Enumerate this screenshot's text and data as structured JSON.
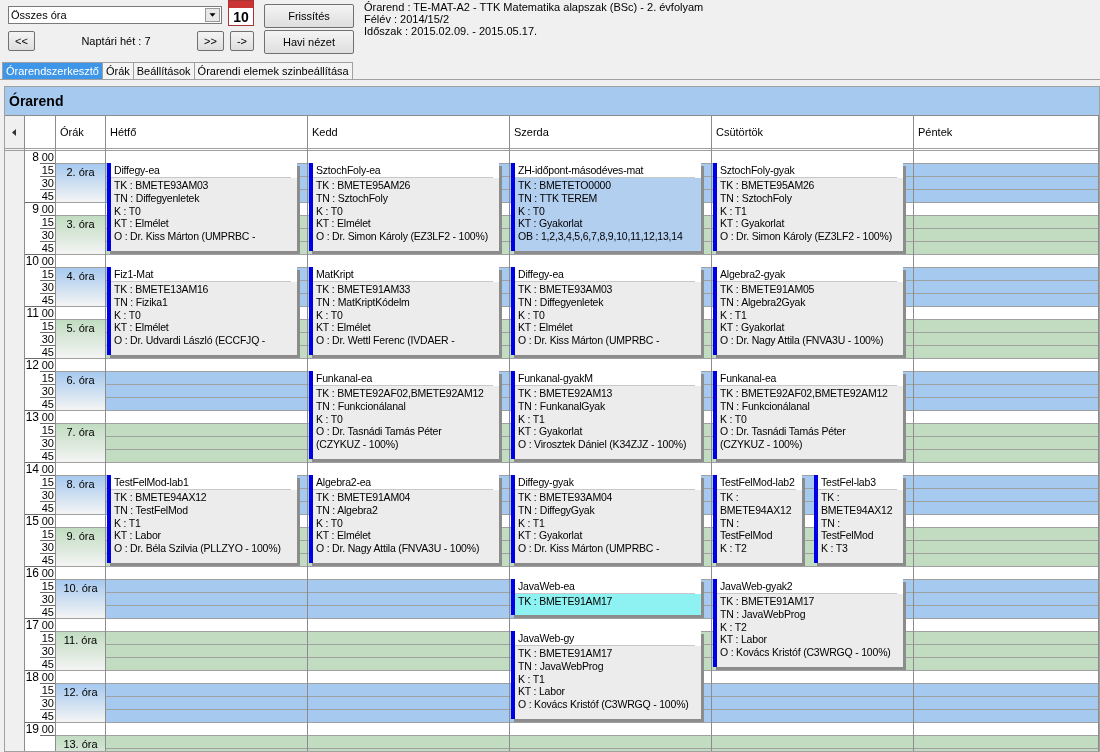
{
  "toolbar": {
    "filter": {
      "value": "Összes óra"
    },
    "calendar_day": "10",
    "prev_button": "<<",
    "week_label": "Naptári hét : 7",
    "next_button": ">>",
    "jump_button": "->",
    "refresh_button": "Frissítés",
    "month_view_button": "Havi nézet"
  },
  "info": [
    "Órarend : TE-MAT-A2 - TTK Matematika alapszak (BSc) - 2. évfolyam",
    "Félév : 2014/15/2",
    "Időszak : 2015.02.09. - 2015.05.17."
  ],
  "tabs": [
    {
      "label": "Órarendszerkesztő",
      "selected": true
    },
    {
      "label": "Órák",
      "selected": false
    },
    {
      "label": "Beállítások",
      "selected": false
    },
    {
      "label": "Órarendi elemek szinbeállítása",
      "selected": false
    }
  ],
  "panel_title": "Órarend",
  "grid": {
    "period_header": "Órák",
    "hours": [
      {
        "hour": "8",
        "minutes": [
          "00",
          "15",
          "30",
          "45"
        ],
        "period": "2. óra",
        "color": "#a6c9ef"
      },
      {
        "hour": "9",
        "minutes": [
          "00",
          "15",
          "30",
          "45"
        ],
        "period": "3. óra",
        "color": "#c1dcc1"
      },
      {
        "hour": "10",
        "minutes": [
          "00",
          "15",
          "30",
          "45"
        ],
        "period": "4. óra",
        "color": "#a6c9ef"
      },
      {
        "hour": "11",
        "minutes": [
          "00",
          "15",
          "30",
          "45"
        ],
        "period": "5. óra",
        "color": "#c1dcc1"
      },
      {
        "hour": "12",
        "minutes": [
          "00",
          "15",
          "30",
          "45"
        ],
        "period": "6. óra",
        "color": "#a6c9ef"
      },
      {
        "hour": "13",
        "minutes": [
          "00",
          "15",
          "30",
          "45"
        ],
        "period": "7. óra",
        "color": "#c1dcc1"
      },
      {
        "hour": "14",
        "minutes": [
          "00",
          "15",
          "30",
          "45"
        ],
        "period": "8. óra",
        "color": "#a6c9ef"
      },
      {
        "hour": "15",
        "minutes": [
          "00",
          "15",
          "30",
          "45"
        ],
        "period": "9. óra",
        "color": "#c1dcc1"
      },
      {
        "hour": "16",
        "minutes": [
          "00",
          "15",
          "30",
          "45"
        ],
        "period": "10. óra",
        "color": "#a6c9ef"
      },
      {
        "hour": "17",
        "minutes": [
          "00",
          "15",
          "30",
          "45"
        ],
        "period": "11. óra",
        "color": "#c1dcc1"
      },
      {
        "hour": "18",
        "minutes": [
          "00",
          "15",
          "30",
          "45"
        ],
        "period": "12. óra",
        "color": "#a6c9ef"
      },
      {
        "hour": "19",
        "minutes": [
          "00"
        ],
        "period": "13. óra",
        "color": "#c1dcc1"
      }
    ],
    "days": [
      {
        "name": "Hétfő",
        "slots": [
          {
            "kind": "two_hours",
            "events": [
              {
                "title": "Diffegy-ea",
                "lines": [
                  "TK : BMETE93AM03",
                  "TN : Diffegyenletek",
                  "K : T0",
                  "KT : Elmélet",
                  "O :  Dr. Kiss Márton (UMPRBC -"
                ],
                "color": "#ececec"
              }
            ]
          },
          {
            "kind": "two_hours",
            "events": [
              {
                "title": "Fiz1-Mat",
                "lines": [
                  "TK : BMETE13AM16",
                  "TN : Fizika1",
                  "K : T0",
                  "KT : Elmélet",
                  "O :  Dr. Udvardi László (ECCFJQ -"
                ],
                "color": "#ececec"
              }
            ]
          },
          {
            "kind": "free"
          },
          {
            "kind": "free"
          },
          {
            "kind": "two_hours",
            "events": [
              {
                "title": "TestFelMod-lab1",
                "lines": [
                  "TK : BMETE94AX12",
                  "TN : TestFelMod",
                  "K : T1",
                  "KT : Labor",
                  "O :  Dr. Béla Szilvia (PLLZYO - 100%)"
                ],
                "color": "#ececec"
              }
            ]
          }
        ]
      },
      {
        "name": "Kedd",
        "slots": [
          {
            "kind": "two_hours",
            "events": [
              {
                "title": "SztochFoly-ea",
                "lines": [
                  "TK : BMETE95AM26",
                  "TN : SztochFoly",
                  "K : T0",
                  "KT : Elmélet",
                  "O :  Dr. Simon Károly (EZ3LF2 - 100%)"
                ],
                "color": "#ececec"
              }
            ]
          },
          {
            "kind": "two_hours",
            "events": [
              {
                "title": "MatKript",
                "lines": [
                  "TK : BMETE91AM33",
                  "TN : MatKriptKódelm",
                  "K : T0",
                  "KT : Elmélet",
                  "O :  Dr. Wettl Ferenc (IVDAER -"
                ],
                "color": "#ececec"
              }
            ]
          },
          {
            "kind": "two_hours",
            "events": [
              {
                "title": "Funkanal-ea",
                "lines": [
                  "TK : BMETE92AF02,BMETE92AM12",
                  "TN : Funkcionálanal",
                  "K : T0",
                  "O :  Dr. Tasnádi Tamás Péter",
                  "(CZYKUZ - 100%)"
                ],
                "color": "#ececec"
              }
            ]
          },
          {
            "kind": "two_hours",
            "events": [
              {
                "title": "Algebra2-ea",
                "lines": [
                  "TK : BMETE91AM04",
                  "TN : Algebra2",
                  "K : T0",
                  "KT : Elmélet",
                  "O :  Dr. Nagy Attila (FNVA3U - 100%)"
                ],
                "color": "#ececec"
              }
            ]
          }
        ]
      },
      {
        "name": "Szerda",
        "slots": [
          {
            "kind": "two_hours",
            "events": [
              {
                "title": "ZH-időpont-másodéves-mat",
                "lines": [
                  "TK : BMETETO0000",
                  "TN : TTK TEREM",
                  "K : T0",
                  "KT : Gyakorlat",
                  "OB : 1,2,3,4,5,6,7,8,9,10,11,12,13,14"
                ],
                "color": "#b3cff0"
              }
            ]
          },
          {
            "kind": "two_hours",
            "events": [
              {
                "title": "Diffegy-ea",
                "lines": [
                  "TK : BMETE93AM03",
                  "TN : Diffegyenletek",
                  "K : T0",
                  "KT : Elmélet",
                  "O :  Dr. Kiss Márton (UMPRBC -"
                ],
                "color": "#ececec"
              }
            ]
          },
          {
            "kind": "two_hours",
            "events": [
              {
                "title": "Funkanal-gyakM",
                "lines": [
                  "TK : BMETE92AM13",
                  "TN : FunkanalGyak",
                  "K : T1",
                  "KT : Gyakorlat",
                  "O :  Virosztek Dániel (K34ZJZ - 100%)"
                ],
                "color": "#ececec"
              }
            ]
          },
          {
            "kind": "two_hours",
            "events": [
              {
                "title": "Diffegy-gyak",
                "lines": [
                  "TK : BMETE93AM04",
                  "TN : DiffegyGyak",
                  "K : T1",
                  "KT : Gyakorlat",
                  "O :  Dr. Kiss Márton (UMPRBC -"
                ],
                "color": "#ececec"
              }
            ]
          },
          {
            "kind": "one_hour",
            "events": [
              {
                "title": "JavaWeb-ea",
                "lines": [
                  "TK : BMETE91AM17"
                ],
                "color": "#8ef2f2"
              }
            ]
          },
          {
            "kind": "two_hours",
            "events": [
              {
                "title": "JavaWeb-gy",
                "lines": [
                  "TK : BMETE91AM17",
                  "TN : JavaWebProg",
                  "K : T1",
                  "KT : Labor",
                  "O :  Kovács Kristóf (C3WRGQ - 100%)"
                ],
                "color": "#ececec"
              }
            ]
          }
        ]
      },
      {
        "name": "Csütörtök",
        "slots": [
          {
            "kind": "two_hours",
            "events": [
              {
                "title": "SztochFoly-gyak",
                "lines": [
                  "TK : BMETE95AM26",
                  "TN : SztochFoly",
                  "K : T1",
                  "KT : Gyakorlat",
                  "O :  Dr. Simon Károly (EZ3LF2 - 100%)"
                ],
                "color": "#ececec"
              }
            ]
          },
          {
            "kind": "two_hours",
            "events": [
              {
                "title": "Algebra2-gyak",
                "lines": [
                  "TK : BMETE91AM05",
                  "TN : Algebra2Gyak",
                  "K : T1",
                  "KT : Gyakorlat",
                  "O :  Dr. Nagy Attila (FNVA3U - 100%)"
                ],
                "color": "#ececec"
              }
            ]
          },
          {
            "kind": "two_hours",
            "events": [
              {
                "title": "Funkanal-ea",
                "lines": [
                  "TK : BMETE92AF02,BMETE92AM12",
                  "TN : Funkcionálanal",
                  "K : T0",
                  "O :  Dr. Tasnádi Tamás Péter",
                  "(CZYKUZ - 100%)"
                ],
                "color": "#ececec"
              }
            ]
          },
          {
            "kind": "two_hours",
            "events": [
              {
                "title": "TestFelMod-lab2",
                "lines": [
                  "TK :",
                  "BMETE94AX12",
                  "TN :",
                  "TestFelMod",
                  "K : T2"
                ],
                "color": "#ececec"
              },
              {
                "title": "TestFel-lab3",
                "lines": [
                  "TK :",
                  "BMETE94AX12",
                  "TN :",
                  "TestFelMod",
                  "K : T3"
                ],
                "color": "#ececec"
              }
            ]
          },
          {
            "kind": "two_hours",
            "events": [
              {
                "title": "JavaWeb-gyak2",
                "lines": [
                  "TK : BMETE91AM17",
                  "TN : JavaWebProg",
                  "K : T2",
                  "KT : Labor",
                  "O :  Kovács Kristóf (C3WRGQ - 100%)"
                ],
                "color": "#ececec"
              }
            ]
          }
        ]
      },
      {
        "name": "Péntek"
      }
    ]
  }
}
